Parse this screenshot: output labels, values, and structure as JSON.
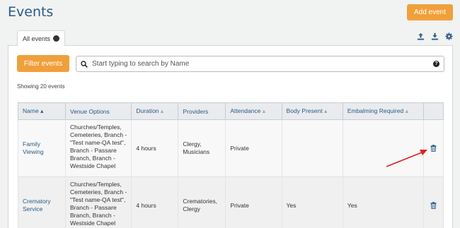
{
  "header": {
    "title": "Events",
    "add_button": "Add event"
  },
  "tabs": [
    {
      "label": "All events",
      "icon": "globe-icon"
    }
  ],
  "toolbar_icons": [
    "upload-icon",
    "download-icon",
    "gear-icon"
  ],
  "filter_button": "Filter events",
  "search": {
    "placeholder": "Start typing to search by Name",
    "value": ""
  },
  "summary": "Showing 20 events",
  "table": {
    "columns": [
      "Name",
      "Venue Options",
      "Duration",
      "Providers",
      "Attendance",
      "Body Present",
      "Embalming Required",
      ""
    ],
    "rows": [
      {
        "name": "Family Viewing",
        "venue": "Churches/Temples, Cemeteries, Branch - \"Test name-QA test\", Branch - Passare Branch, Branch - Westside Chapel",
        "duration": "4 hours",
        "providers": "Clergy, Musicians",
        "attendance": "Private",
        "body_present": "",
        "embalming": ""
      },
      {
        "name": "Crematory Service",
        "venue": "Churches/Temples, Cemeteries, Branch - \"Test name-QA test\", Branch - Passare Branch, Branch - Westside Chapel",
        "duration": "4 hours",
        "providers": "Crematories, Clergy",
        "attendance": "Private",
        "body_present": "Yes",
        "embalming": "Yes"
      }
    ]
  },
  "colors": {
    "accent": "#f0a03a",
    "link": "#2a5b86",
    "annotation": "#e02020"
  }
}
